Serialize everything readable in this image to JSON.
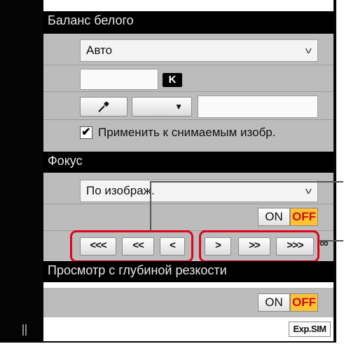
{
  "white_balance": {
    "header": "Баланс белого",
    "mode_value": "Авто",
    "kelvin_badge": "K",
    "apply_checkbox_label": "Применить к снимаемым изобр.",
    "apply_checked": true
  },
  "focus": {
    "header": "Фокус",
    "mode_value": "По изображ.",
    "on_label": "ON",
    "off_label": "OFF",
    "active_state": "OFF",
    "nav_buttons": [
      "<<<",
      "<<",
      "<",
      ">",
      ">>",
      ">>>"
    ],
    "infinity_symbol": "∞"
  },
  "depth_of_field": {
    "header": "Просмотр с глубиной резкости",
    "on_label": "ON",
    "off_label": "OFF",
    "active_state": "OFF"
  },
  "footer": {
    "exp_sim_label": "Exp.SIM"
  },
  "colors": {
    "highlight_red": "#e3001b",
    "off_active": "#ffc233",
    "panel_gray": "#bcbcbc",
    "header_black": "#000000"
  }
}
